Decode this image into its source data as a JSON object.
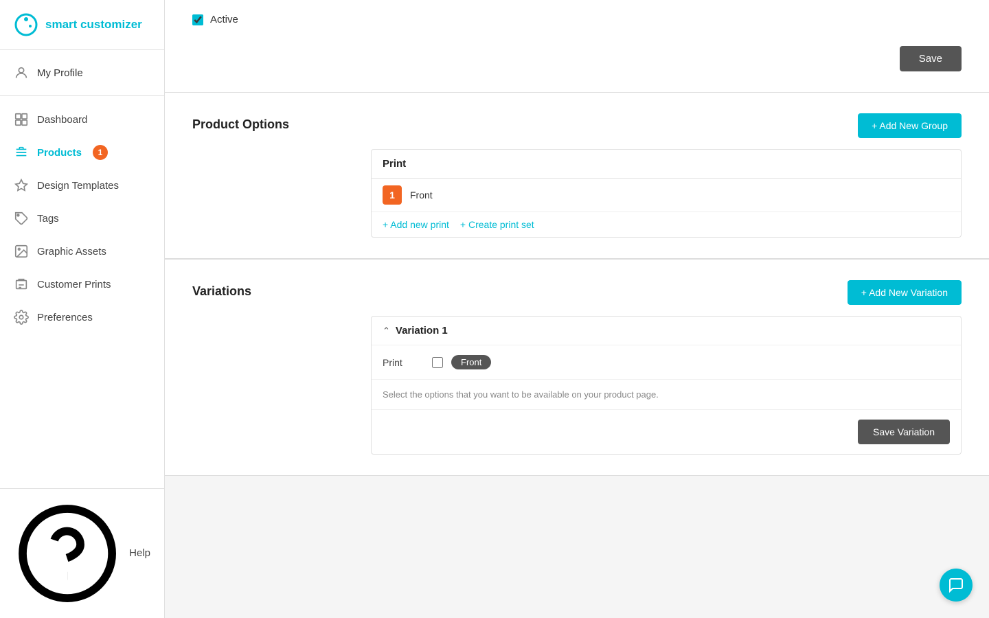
{
  "brand": {
    "logo_text": "smart customizer",
    "logo_alt": "Smart Customizer Logo"
  },
  "sidebar": {
    "profile": {
      "label": "My Profile"
    },
    "nav_items": [
      {
        "id": "dashboard",
        "label": "Dashboard",
        "icon": "dashboard-icon",
        "active": false,
        "badge": null
      },
      {
        "id": "products",
        "label": "Products",
        "icon": "products-icon",
        "active": true,
        "badge": "1"
      },
      {
        "id": "design-templates",
        "label": "Design Templates",
        "icon": "design-templates-icon",
        "active": false,
        "badge": null
      },
      {
        "id": "tags",
        "label": "Tags",
        "icon": "tags-icon",
        "active": false,
        "badge": null
      },
      {
        "id": "graphic-assets",
        "label": "Graphic Assets",
        "icon": "graphic-assets-icon",
        "active": false,
        "badge": null
      },
      {
        "id": "customer-prints",
        "label": "Customer Prints",
        "icon": "customer-prints-icon",
        "active": false,
        "badge": null
      },
      {
        "id": "preferences",
        "label": "Preferences",
        "icon": "preferences-icon",
        "active": false,
        "badge": null
      }
    ],
    "help": {
      "label": "Help"
    }
  },
  "active_section": {
    "checkbox_label": "Active",
    "checked": true,
    "save_button": "Save"
  },
  "product_options": {
    "section_label": "Product Options",
    "add_group_button": "+ Add New Group",
    "group": {
      "name": "Print",
      "items": [
        {
          "number": "1",
          "name": "Front"
        }
      ],
      "actions": [
        {
          "label": "+ Add new print"
        },
        {
          "label": "+ Create print set"
        }
      ]
    }
  },
  "variations": {
    "section_label": "Variations",
    "add_variation_button": "+ Add New Variation",
    "items": [
      {
        "name": "Variation 1",
        "expanded": true,
        "options": [
          {
            "label": "Print",
            "checked": false,
            "tags": [
              "Front"
            ]
          }
        ],
        "hint": "Select the options that you want to be available on your product page.",
        "save_button": "Save Variation"
      }
    ]
  },
  "chat": {
    "icon": "chat-icon"
  }
}
